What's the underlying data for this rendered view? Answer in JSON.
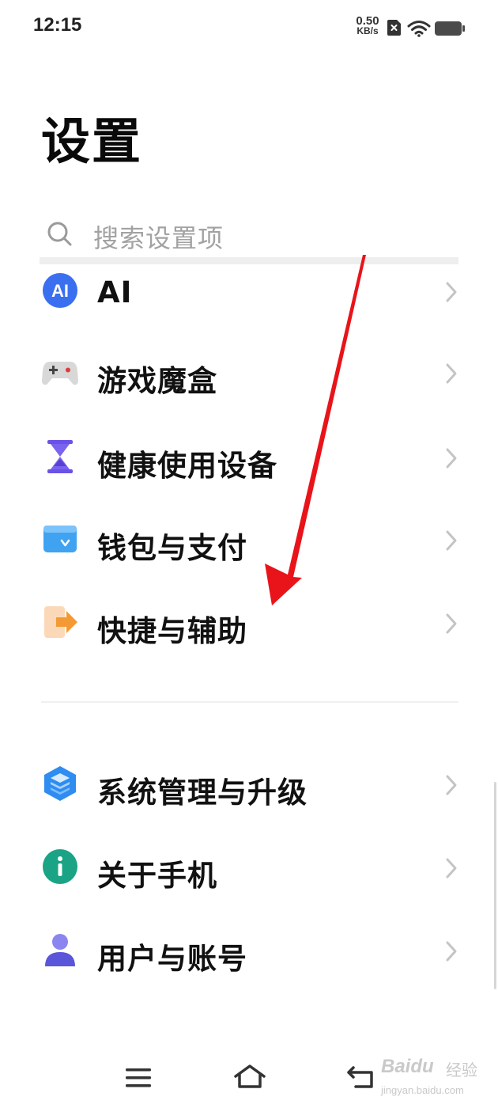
{
  "status_bar": {
    "time": "12:15",
    "net_speed_value": "0.50",
    "net_speed_unit": "KB/s",
    "icons": [
      "sim-off-icon",
      "wifi-icon",
      "battery-icon"
    ]
  },
  "page": {
    "title": "设置"
  },
  "search": {
    "placeholder": "搜索设置项",
    "icon": "search-icon"
  },
  "settings_items": [
    {
      "label": "AI",
      "icon": "ai-icon",
      "icon_color": "#3a6ff0"
    },
    {
      "label": "游戏魔盒",
      "icon": "gamepad-icon",
      "icon_color": "#d8d8d8"
    },
    {
      "label": "健康使用设备",
      "icon": "hourglass-icon",
      "icon_color": "#6a52e8"
    },
    {
      "label": "钱包与支付",
      "icon": "wallet-icon",
      "icon_color": "#3fa3f2"
    },
    {
      "label": "快捷与辅助",
      "icon": "shortcut-icon",
      "icon_color": "#f49a35"
    },
    {
      "label": "系统管理与升级",
      "icon": "system-layers-icon",
      "icon_color": "#2f8cf0"
    },
    {
      "label": "关于手机",
      "icon": "info-icon",
      "icon_color": "#1aa385"
    },
    {
      "label": "用户与账号",
      "icon": "user-icon",
      "icon_color": "#5b55d9"
    }
  ],
  "annotation": {
    "color": "#e8141a"
  },
  "nav_bar": {
    "buttons": [
      "menu-icon",
      "home-icon",
      "back-icon"
    ]
  },
  "watermark": {
    "brand": "Baidu",
    "cn": "经验",
    "url": "jingyan.baidu.com"
  }
}
